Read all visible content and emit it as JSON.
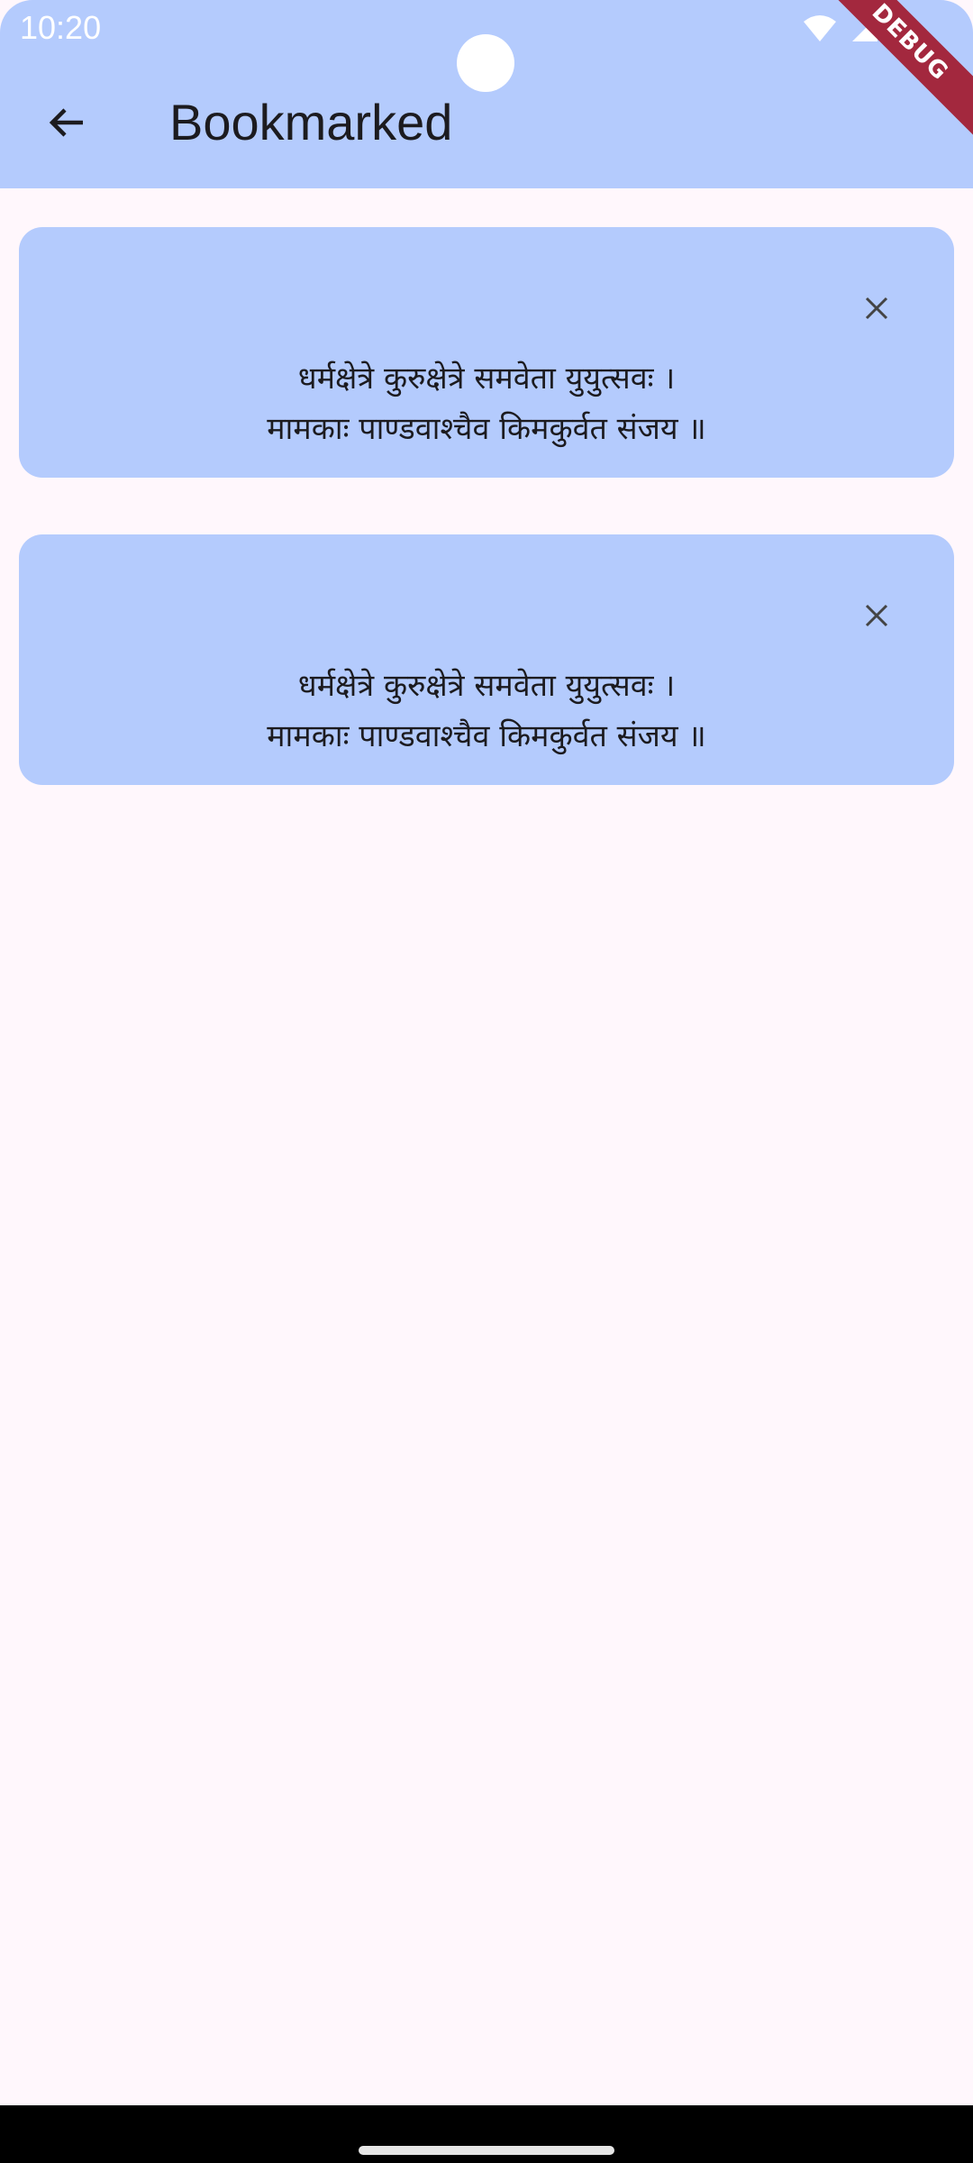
{
  "status_bar": {
    "time": "10:20",
    "icons": [
      "wifi-icon",
      "signal-icon",
      "battery-icon"
    ]
  },
  "debug_banner": "DEBUG",
  "app_bar": {
    "back_icon": "arrow-back-icon",
    "title": "Bookmarked"
  },
  "bookmarks": [
    {
      "close_icon": "close-icon",
      "line1": "धर्मक्षेत्रे कुरुक्षेत्रे समवेता युयुत्सवः ।",
      "line2": "मामकाः पाण्डवाश्चैव किमकुर्वत संजय ॥"
    },
    {
      "close_icon": "close-icon",
      "line1": "धर्मक्षेत्रे कुरुक्षेत्रे समवेता युयुत्सवः ।",
      "line2": "मामकाः पाण्डवाश्चैव किमकुर्वत संजय ॥"
    }
  ],
  "colors": {
    "app_bar": "#b4cbfd",
    "card": "#b4cbfd",
    "background": "#fff7fc",
    "debug_ribbon": "#a3283e"
  }
}
